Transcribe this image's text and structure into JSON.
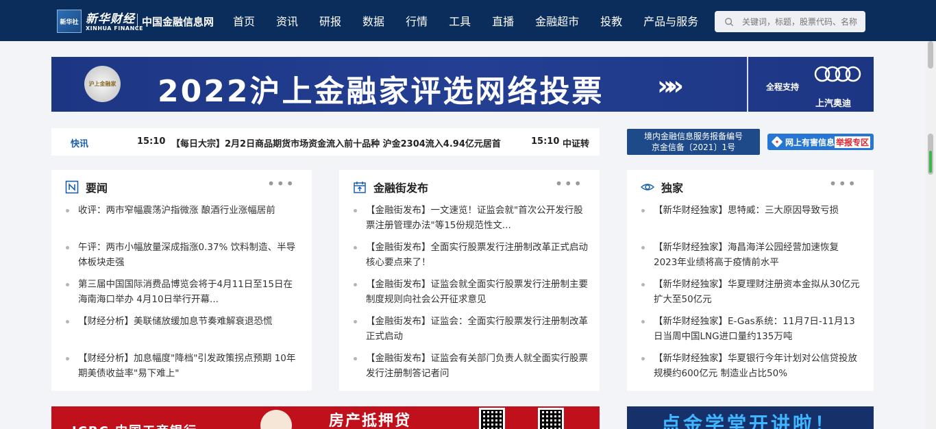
{
  "header": {
    "logo_text": "新华财经",
    "logo_sub": "XINHUA FINANCE",
    "logo_mark": "新华社",
    "site_name": "中国金融信息网",
    "nav": [
      "首页",
      "资讯",
      "研报",
      "数据",
      "行情",
      "工具",
      "直播",
      "金融超市",
      "投教",
      "产品与服务"
    ],
    "search_placeholder": "关键词，标题，股票代码、名称"
  },
  "banner": {
    "medal_text": "沪上金融家",
    "title": "2022沪上金融家评选网络投票",
    "arrows": "»»",
    "sponsor_label": "全程支持",
    "sponsor_name": "上汽奥迪"
  },
  "ticker": {
    "label": "快讯",
    "items": [
      {
        "time": "15:10",
        "text": "【每日大宗】2月2日商品期货市场资金流入前十品种 沪金2304流入4.94亿元居首"
      },
      {
        "time": "15:10",
        "text": "中证转"
      }
    ]
  },
  "license": {
    "line1": "境内金融信息服务报备编号",
    "line2": "京金信备〔2021〕1号"
  },
  "report": {
    "text": "网上有害信息",
    "highlight": "举报专区"
  },
  "cards": [
    {
      "title": "要闻",
      "icon": "news-icon",
      "more": "•••",
      "items": [
        "收评：两市窄幅震荡沪指微涨 酿酒行业涨幅居前",
        "午评：两市小幅放量深成指涨0.37% 饮料制造、半导体板块走强",
        "第三届中国国际消费品博览会将于4月11日至15日在海南海口举办 4月10日举行开幕...",
        "【财经分析】美联储放缓加息节奏难解衰退恐慌",
        "【财经分析】加息幅度\"降档\"引发政策拐点预期 10年期美债收益率\"易下难上\""
      ]
    },
    {
      "title": "金融街发布",
      "icon": "calendar-icon",
      "more": "•••",
      "items": [
        "【金融街发布】一文速览！证监会就\"首次公开发行股票注册管理办法\"等15份规范性文...",
        "【金融街发布】全面实行股票发行注册制改革正式启动 核心要点来了！",
        "【金融街发布】证监会就全面实行股票发行注册制主要制度规则向社会公开征求意见",
        "【金融街发布】证监会：全面实行股票发行注册制改革正式启动",
        "【金融街发布】证监会有关部门负责人就全面实行股票发行注册制答记者问"
      ]
    },
    {
      "title": "独家",
      "icon": "eye-icon",
      "more": "•••",
      "items": [
        "【新华财经独家】思特威：三大原因导致亏损",
        "【新华财经独家】海昌海洋公园经营加速恢复 2023年业绩将高于疫情前水平",
        "【新华财经独家】华夏理财注册资本金拟从30亿元扩大至50亿元",
        "【新华财经独家】E-Gas系统：11月7日-11月13日当周中国LNG进口量约135万吨",
        "【新华财经独家】华夏银行今年计划对公信贷投放规模约600亿元 制造业占比50%"
      ]
    }
  ],
  "ads": {
    "bank_name": "ICBC 中国工商银行",
    "bank_title": "房产抵押贷",
    "school_title": "点金学堂开讲啦！"
  }
}
